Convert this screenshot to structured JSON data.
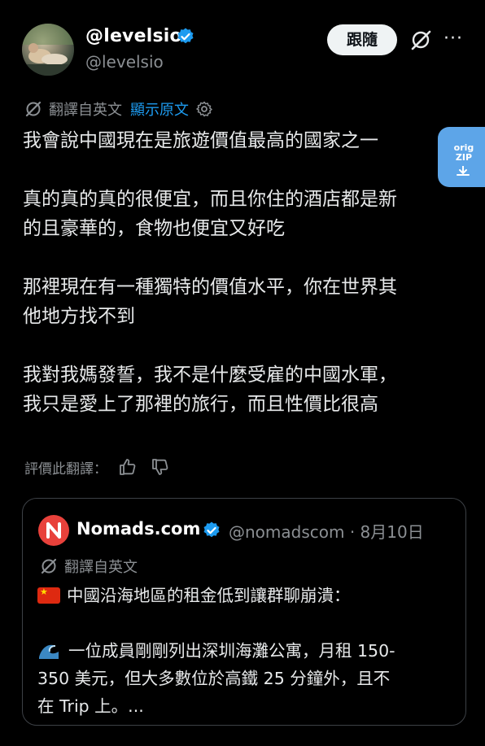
{
  "header": {
    "display_name": "@levelsio",
    "handle": "@levelsio",
    "follow_label": "跟隨",
    "more_label": "···"
  },
  "translation": {
    "note": "翻譯自英文",
    "show_original": "顯示原文"
  },
  "post": {
    "paragraphs": [
      "我會說中國現在是旅遊價值最高的國家之一",
      "真的真的真的很便宜，而且你住的酒店都是新\n的且豪華的，食物也便宜又好吃",
      "那裡現在有一種獨特的價值水平，你在世界其\n他地方找不到",
      "我對我媽發誓，我不是什麼受雇的中國水軍，\n我只是愛上了那裡的旅行，而且性價比很高"
    ]
  },
  "side_extension": {
    "label": "orig\nZIP"
  },
  "rating": {
    "label": "評價此翻譯："
  },
  "quote": {
    "name": "Nomads.com",
    "meta": "@nomadscom · 8月10日",
    "translation_note": "翻譯自英文",
    "line1": "中國沿海地區的租金低到讓群聊崩潰：",
    "line2": "一位成員剛剛列出深圳海灘公寓，月租 150-\n350 美元，但大多數位於高鐵 25 分鐘外，且不\n在 Trip 上。..."
  },
  "colors": {
    "background": "#000000",
    "text": "#e7e9ea",
    "muted": "#8b8f93",
    "link": "#1d9bf0",
    "verified": "#1d9bf0",
    "follow_bg": "#eff3f4",
    "nomads_logo": "#e8413b",
    "extension_bg": "#5da5e8"
  },
  "icons": {
    "verified": "verified-badge-icon",
    "grok": "grok-slash-icon",
    "more": "more-dots-icon",
    "translate": "translate-icon",
    "settings": "gear-icon",
    "thumbs_up": "thumbs-up-icon",
    "thumbs_down": "thumbs-down-icon",
    "flag": "china-flag-icon",
    "wave": "wave-emoji-icon"
  }
}
